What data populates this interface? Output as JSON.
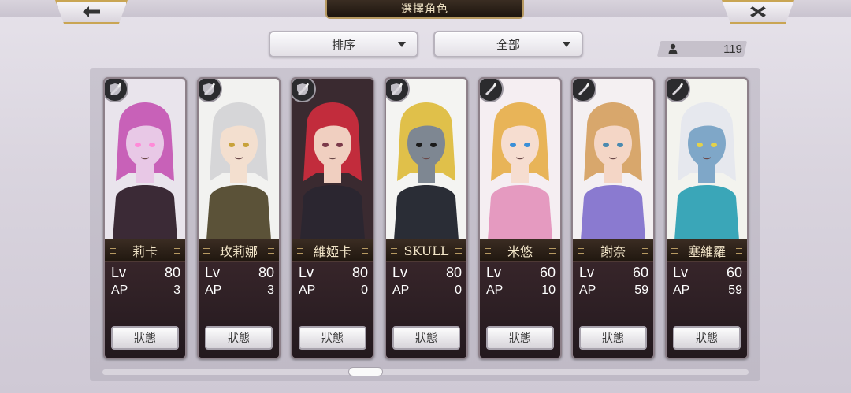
{
  "header": {
    "title": "選擇角色",
    "back_icon": "arrow-left-icon",
    "close_icon": "close-icon"
  },
  "toolbar": {
    "sort_label": "排序",
    "filter_label": "全部",
    "count_icon": "person-icon",
    "character_count": "119"
  },
  "cards": [
    {
      "name": "莉卡",
      "lv_label": "Lv",
      "lv": "80",
      "ap_label": "AP",
      "ap": "3",
      "button": "狀態",
      "element_icon": "sword-shield-icon",
      "portrait": {
        "bg": "#e9e4ec",
        "hair": "#c861b8",
        "skin": "#e8c8e6",
        "outfit": "#3b2a36",
        "eyes": "#ff8ad8"
      }
    },
    {
      "name": "玫莉娜",
      "lv_label": "Lv",
      "lv": "80",
      "ap_label": "AP",
      "ap": "3",
      "button": "狀態",
      "element_icon": "sword-shield-icon",
      "portrait": {
        "bg": "#f2f2f0",
        "hair": "#d6d6d8",
        "skin": "#f3dfcf",
        "outfit": "#5b5238",
        "eyes": "#c8a23a"
      }
    },
    {
      "name": "維婭卡",
      "lv_label": "Lv",
      "lv": "80",
      "ap_label": "AP",
      "ap": "0",
      "button": "狀態",
      "element_icon": "sword-shield-icon",
      "portrait": {
        "bg": "#3a2a30",
        "hair": "#c22c3c",
        "skin": "#f0cfc0",
        "outfit": "#2b2630",
        "eyes": "#7b3a4a"
      }
    },
    {
      "name": "SKULL",
      "lv_label": "Lv",
      "lv": "80",
      "ap_label": "AP",
      "ap": "0",
      "button": "狀態",
      "element_icon": "sword-shield-icon",
      "portrait": {
        "bg": "#f4f4f2",
        "hair": "#e0c04a",
        "skin": "#7e8792",
        "outfit": "#2a2d36",
        "eyes": "#1a1a1a"
      }
    },
    {
      "name": "米悠",
      "lv_label": "Lv",
      "lv": "60",
      "ap_label": "AP",
      "ap": "10",
      "button": "狀態",
      "element_icon": "sword-icon",
      "portrait": {
        "bg": "#f5eef2",
        "hair": "#e8b458",
        "skin": "#f6ddd0",
        "outfit": "#e59ac0",
        "eyes": "#3a8fd8"
      }
    },
    {
      "name": "謝奈",
      "lv_label": "Lv",
      "lv": "60",
      "ap_label": "AP",
      "ap": "59",
      "button": "狀態",
      "element_icon": "sword-icon",
      "portrait": {
        "bg": "#f4f0f2",
        "hair": "#d8a76c",
        "skin": "#f4d6c6",
        "outfit": "#8a7ad0",
        "eyes": "#4a8ab0"
      }
    },
    {
      "name": "塞維羅",
      "lv_label": "Lv",
      "lv": "60",
      "ap_label": "AP",
      "ap": "59",
      "button": "狀態",
      "element_icon": "sword-icon",
      "portrait": {
        "bg": "#f3f3ee",
        "hair": "#e6e8ee",
        "skin": "#7fa7c8",
        "outfit": "#3aa6b8",
        "eyes": "#e4d24a"
      }
    }
  ]
}
